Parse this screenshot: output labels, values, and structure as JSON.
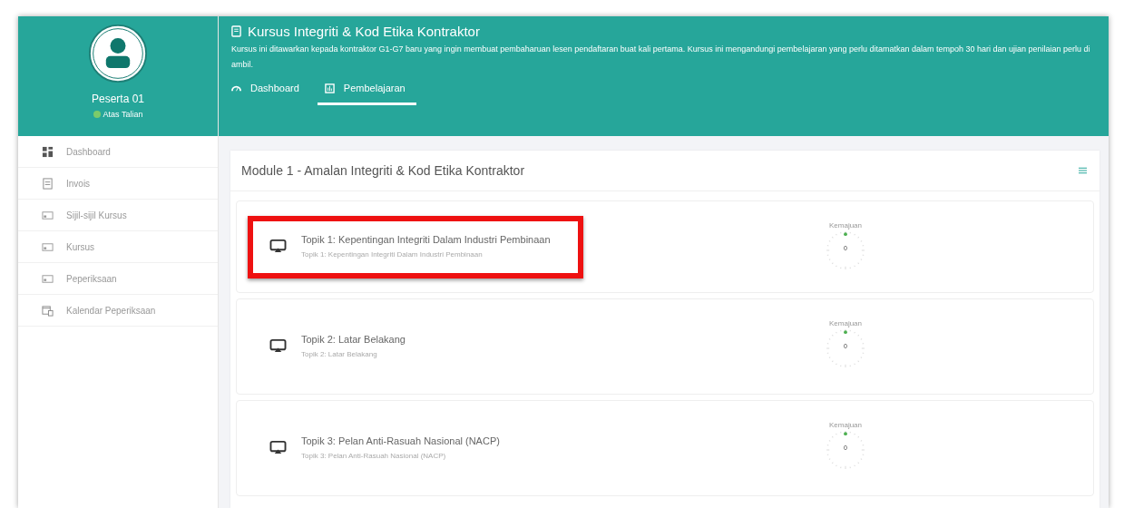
{
  "profile": {
    "name": "Peserta 01",
    "status": "Atas Talian",
    "online": true
  },
  "sidebar": {
    "items": [
      {
        "label": "Dashboard",
        "kind": "grid",
        "selected": false
      },
      {
        "label": "Invois",
        "kind": "invoice",
        "selected": false
      },
      {
        "label": "Sijil-sijil Kursus",
        "kind": "card",
        "selected": false
      },
      {
        "label": "Kursus",
        "kind": "card",
        "selected": false
      },
      {
        "label": "Peperiksaan",
        "kind": "card",
        "selected": false
      },
      {
        "label": "Kalendar Peperiksaan",
        "kind": "calendar",
        "selected": false
      }
    ]
  },
  "header": {
    "title": "Kursus Integriti & Kod Etika Kontraktor",
    "description": "Kursus ini ditawarkan kepada kontraktor G1-G7 baru yang ingin membuat pembaharuan lesen pendaftaran buat kali pertama. Kursus ini mengandungi pembelajaran yang perlu ditamatkan dalam tempoh 30 hari dan ujian penilaian perlu di ambil.",
    "tabs": [
      {
        "label": "Dashboard",
        "kind": "gauge",
        "selected": false
      },
      {
        "label": "Pembelajaran",
        "kind": "board",
        "selected": true
      }
    ]
  },
  "module": {
    "title": "Module 1 - Amalan Integriti & Kod Etika Kontraktor",
    "topics": [
      {
        "title": "Topik 1: Kepentingan Integriti Dalam Industri Pembinaan",
        "subtitle": "Topik 1: Kepentingan Integriti Dalam Industri Pembinaan",
        "highlighted": true,
        "progress_label": "Kemajuan",
        "progress_value": "0"
      },
      {
        "title": "Topik 2: Latar Belakang",
        "subtitle": "Topik 2: Latar Belakang",
        "highlighted": false,
        "progress_label": "Kemajuan",
        "progress_value": "0"
      },
      {
        "title": "Topik 3: Pelan Anti-Rasuah Nasional (NACP)",
        "subtitle": "Topik 3: Pelan Anti-Rasuah Nasional (NACP)",
        "highlighted": false,
        "progress_label": "Kemajuan",
        "progress_value": "0"
      }
    ]
  }
}
